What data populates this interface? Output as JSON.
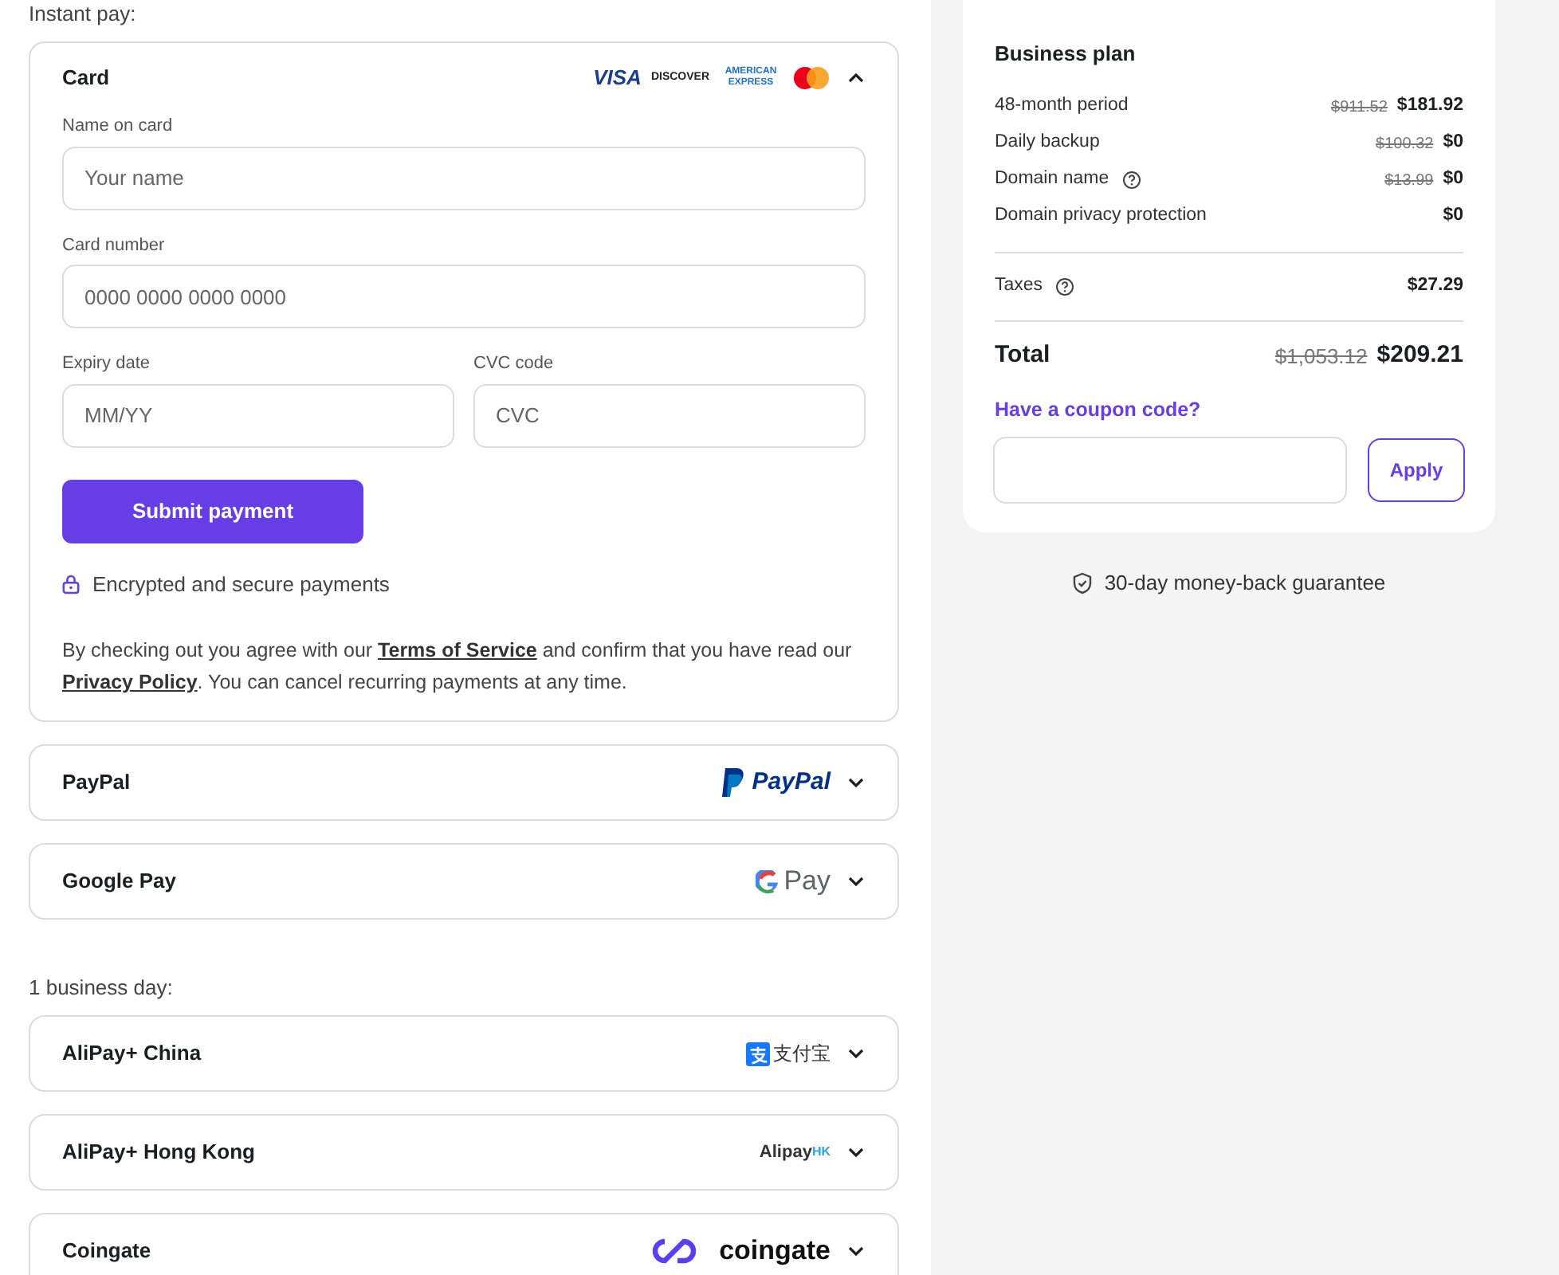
{
  "payment_groups": [
    {
      "heading": "Instant pay:",
      "methods": [
        {
          "kind": "card",
          "name": "Card",
          "expanded": true,
          "logos": [
            "VISA",
            "DISCOVER",
            "AMERICAN EXPRESS"
          ],
          "fields": [
            {
              "label": "Name on card",
              "placeholder": "Your name"
            },
            {
              "label": "Card number",
              "placeholder": "0000 0000 0000 0000"
            },
            {
              "label": "Expiry date",
              "placeholder": "MM/YY"
            },
            {
              "label": "CVC code",
              "placeholder": "CVC"
            }
          ],
          "submit": "Submit payment",
          "secure_note": "Encrypted and secure payments",
          "terms": [
            {
              "kind": "text",
              "text": "By checking out you agree with our "
            },
            {
              "kind": "link",
              "text": "Terms of Service"
            },
            {
              "kind": "text",
              "text": " and confirm that you have read our "
            },
            {
              "kind": "link",
              "text": "Privacy Policy"
            },
            {
              "kind": "text",
              "text": ". You can cancel recurring payments at any time."
            }
          ]
        },
        {
          "kind": "paypal",
          "name": "PayPal",
          "expanded": false,
          "logo": "PayPal"
        },
        {
          "kind": "gpay",
          "name": "Google Pay",
          "expanded": false,
          "logo": "Pay"
        }
      ]
    },
    {
      "heading": "1 business day:",
      "methods": [
        {
          "kind": "alipay",
          "name": "AliPay+ China",
          "expanded": false,
          "logo": "支付宝"
        },
        {
          "kind": "alipayhk",
          "name": "AliPay+ Hong Kong",
          "expanded": false,
          "logo": "Alipay",
          "logo_suffix": "HK"
        },
        {
          "kind": "coingate",
          "name": "Coingate",
          "expanded": false,
          "logo": "coingate"
        }
      ]
    }
  ],
  "summary": {
    "plan": "Business plan",
    "items": [
      {
        "label": "48-month period",
        "old_price": "$911.52",
        "price": "$181.92",
        "help": false
      },
      {
        "label": "Daily backup",
        "old_price": "$100.32",
        "price": "$0",
        "help": false
      },
      {
        "label": "Domain name",
        "old_price": "$13.99",
        "price": "$0",
        "help": true
      },
      {
        "label": "Domain privacy protection",
        "price": "$0",
        "help": false
      }
    ],
    "taxes": {
      "label": "Taxes",
      "price": "$27.29",
      "help": true
    },
    "total": {
      "label": "Total",
      "old_price": "$1,053.12",
      "price": "$209.21"
    },
    "coupon_link": "Have a coupon code?",
    "apply": "Apply"
  },
  "guarantee": "30-day money-back guarantee"
}
